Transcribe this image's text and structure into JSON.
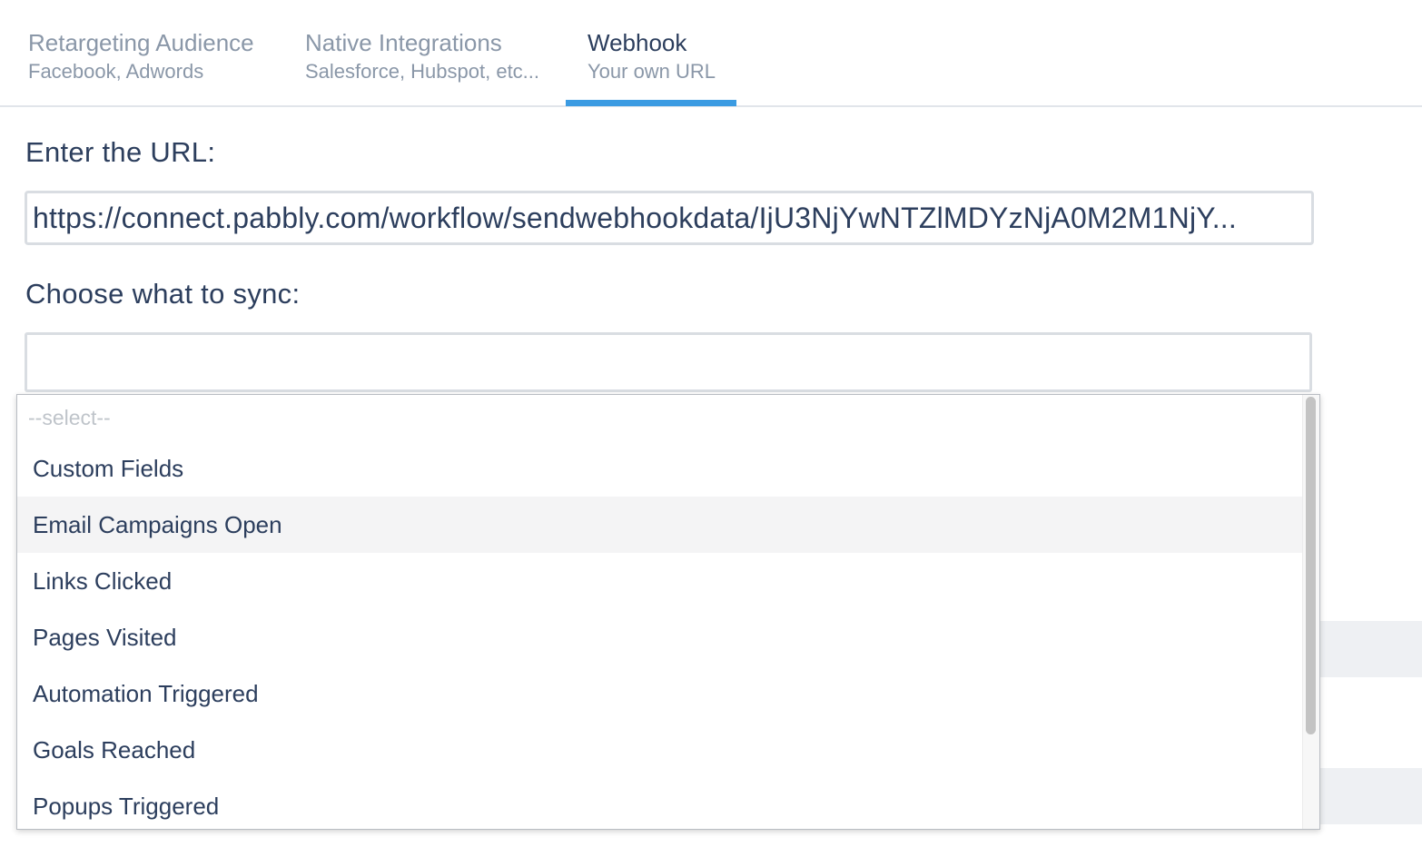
{
  "tabs": [
    {
      "title": "Retargeting Audience",
      "subtitle": "Facebook, Adwords"
    },
    {
      "title": "Native Integrations",
      "subtitle": "Salesforce, Hubspot, etc..."
    },
    {
      "title": "Webhook",
      "subtitle": "Your own URL"
    }
  ],
  "active_tab": "Webhook",
  "form": {
    "url_label": "Enter the URL:",
    "url_value": "https://connect.pabbly.com/workflow/sendwebhookdata/IjU3NjYwNTZlMDYzNjA0M2M1NjY...",
    "sync_label": "Choose what to sync:",
    "sync_value": ""
  },
  "dropdown": {
    "placeholder": "--select--",
    "options": [
      "Custom Fields",
      "Email Campaigns Open",
      "Links Clicked",
      "Pages Visited",
      "Automation Triggered",
      "Goals Reached",
      "Popups Triggered"
    ],
    "hovered_option": "Email Campaigns Open"
  },
  "colors": {
    "accent": "#3b9be2",
    "text": "#2c3e5d",
    "muted": "#8a97a8",
    "border": "#d9dde2"
  }
}
